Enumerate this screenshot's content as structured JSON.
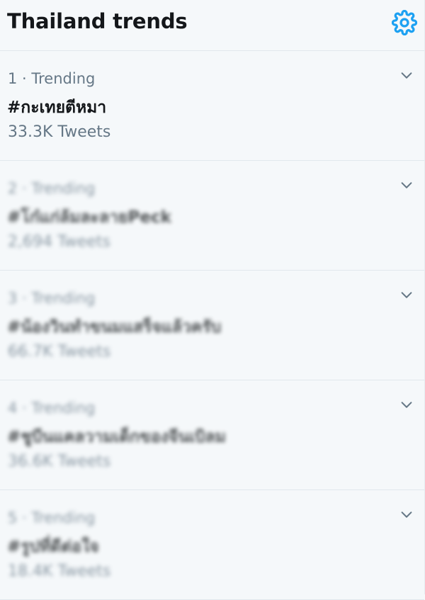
{
  "header": {
    "title": "Thailand trends"
  },
  "trends": [
    {
      "meta": "1 · Trending",
      "name": "#กะเทยตีหมา",
      "count": "33.3K Tweets"
    },
    {
      "meta": "2 · Trending",
      "name": "#โก๋แก่ล้มละลายPeck",
      "count": "2,694 Tweets"
    },
    {
      "meta": "3 · Trending",
      "name": "#น้องวินทำขนมแสร็จแล้วครับ",
      "count": "66.7K Tweets"
    },
    {
      "meta": "4 · Trending",
      "name": "#ชูบีนแคลวามเด็กของจีนเบิลม",
      "count": "36.6K Tweets"
    },
    {
      "meta": "5 · Trending",
      "name": "#รูปที่ดีต่อใจ",
      "count": "18.4K Tweets"
    }
  ],
  "colors": {
    "accent": "#1da1f2",
    "background": "#f5f8fa",
    "text_primary": "#14171a",
    "text_secondary": "#657786",
    "divider": "#e1e8ed"
  },
  "icons": {
    "settings": "gear-icon",
    "more": "chevron-down-icon"
  }
}
